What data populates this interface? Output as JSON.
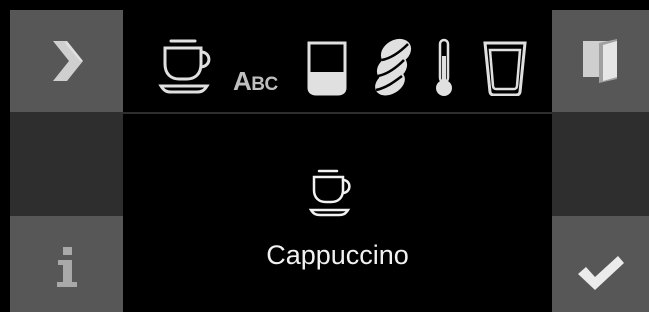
{
  "left_panel": {
    "next_icon": "chevron-right-icon",
    "info_icon": "info-icon"
  },
  "right_panel": {
    "menu_icon": "book-icon",
    "confirm_icon": "checkmark-icon"
  },
  "toolbar": {
    "items": [
      {
        "name": "drink-type",
        "icon": "coffee-cup-icon"
      },
      {
        "name": "rename",
        "text": "ABC",
        "text_cap": "A",
        "text_small": "BC"
      },
      {
        "name": "amount",
        "icon": "glass-amount-icon"
      },
      {
        "name": "strength",
        "icon": "coffee-beans-icon"
      },
      {
        "name": "temperature",
        "icon": "thermometer-icon"
      },
      {
        "name": "milk",
        "icon": "milk-glass-icon"
      }
    ]
  },
  "selection": {
    "icon": "coffee-cup-icon",
    "name": "Cappuccino"
  },
  "colors": {
    "button_gray": "#575757",
    "panel_dark": "#2e2e2e",
    "background": "#000000",
    "icon_light": "#d9d9d9",
    "text": "#f2f2f2"
  }
}
